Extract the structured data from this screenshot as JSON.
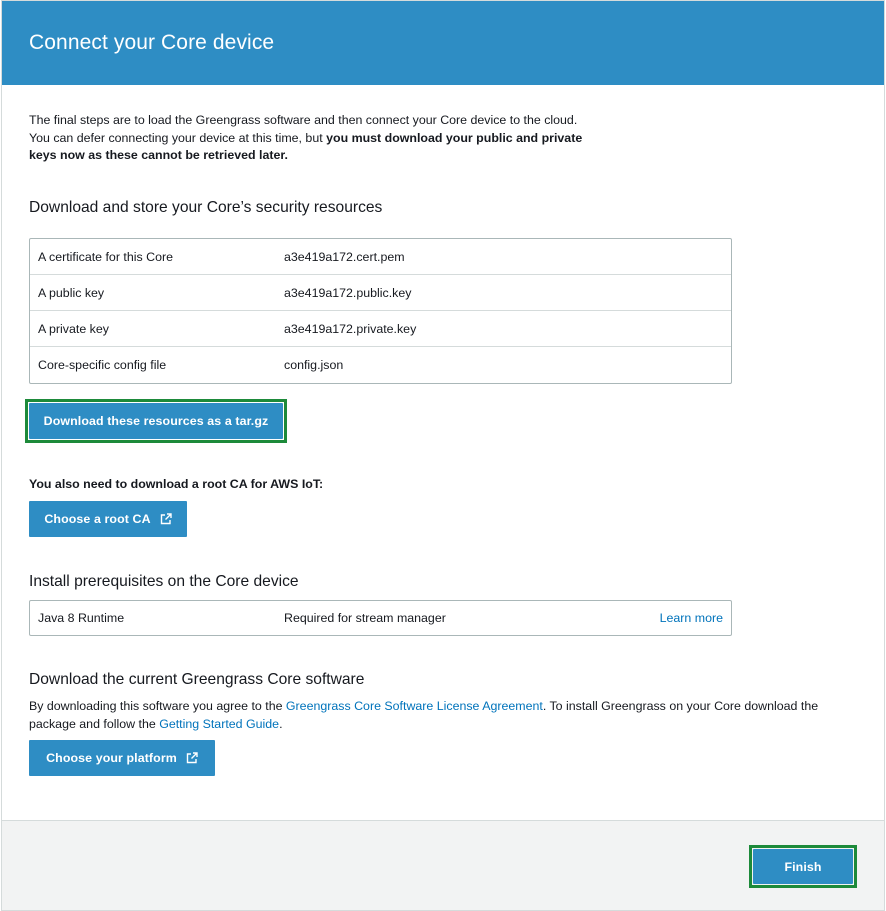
{
  "header": {
    "title": "Connect your Core device"
  },
  "intro": {
    "text": "The final steps are to load the Greengrass software and then connect your Core device to the cloud. You can defer connecting your device at this time, but ",
    "bold": "you must download your public and private keys now as these cannot be retrieved later."
  },
  "security": {
    "heading": "Download and store your Core’s security resources",
    "rows": [
      {
        "label": "A certificate for this Core",
        "value": "a3e419a172.cert.pem"
      },
      {
        "label": "A public key",
        "value": "a3e419a172.public.key"
      },
      {
        "label": "A private key",
        "value": "a3e419a172.private.key"
      },
      {
        "label": "Core-specific config file",
        "value": "config.json"
      }
    ],
    "download_button": "Download these resources as a tar.gz"
  },
  "root_ca": {
    "label": "You also need to download a root CA for AWS IoT:",
    "button": "Choose a root CA"
  },
  "prerequisites": {
    "heading": "Install prerequisites on the Core device",
    "row": {
      "name": "Java 8 Runtime",
      "desc": "Required for stream manager",
      "link": "Learn more"
    }
  },
  "software": {
    "heading": "Download the current Greengrass Core software",
    "text_1": "By downloading this software you agree to the ",
    "link_1": "Greengrass Core Software License Agreement",
    "text_2": ". To install Greengrass on your Core download the package and follow the ",
    "link_2": "Getting Started Guide",
    "text_3": ".",
    "button": "Choose your platform"
  },
  "footer": {
    "finish_button": "Finish"
  },
  "colors": {
    "header": "#2e8dc4",
    "button": "#2e8dc4",
    "link": "#0073bb",
    "highlight": "#1d8a3a"
  },
  "icons": {
    "external_link": "external-link-icon"
  }
}
